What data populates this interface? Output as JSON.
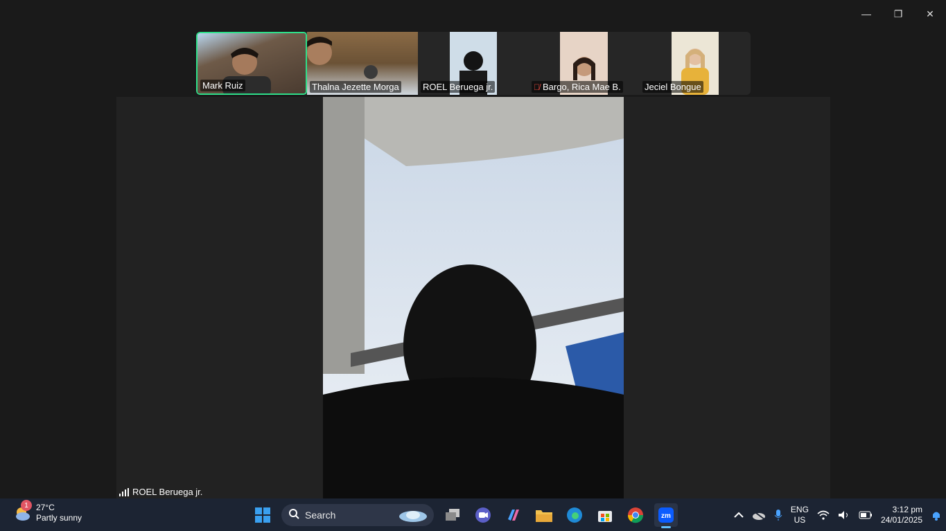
{
  "window": {
    "controls": {
      "minimize": "—",
      "restore": "❐",
      "close": "✕"
    }
  },
  "participants": [
    {
      "name": "Mark Ruiz",
      "active": true,
      "muted": false
    },
    {
      "name": "Thalna Jezette Morga",
      "active": false,
      "muted": false
    },
    {
      "name": "ROEL Beruega jr.",
      "active": false,
      "muted": false
    },
    {
      "name": "Bargo, Rica Mae B.",
      "active": false,
      "muted": true
    },
    {
      "name": "Jeciel Bongue",
      "active": false,
      "muted": false
    }
  ],
  "speaker": {
    "name": "ROEL Beruega jr."
  },
  "taskbar": {
    "weather": {
      "temp": "27°C",
      "condition": "Partly sunny",
      "badge": "1"
    },
    "search": {
      "placeholder": "Search"
    },
    "language": {
      "lang": "ENG",
      "region": "US"
    },
    "clock": {
      "time": "3:12 pm",
      "date": "24/01/2025"
    }
  },
  "colors": {
    "active_border": "#2ee08a",
    "taskbar": "#1c2433",
    "mute": "#e0463c"
  }
}
